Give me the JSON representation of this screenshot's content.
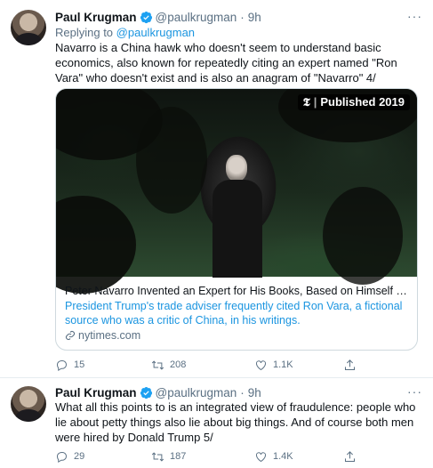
{
  "tweets": [
    {
      "author": {
        "name": "Paul Krugman",
        "handle": "@paulkrugman",
        "separator": "·",
        "time": "9h"
      },
      "more_icon": "ellipsis-icon",
      "replying_prefix": "Replying to",
      "replying_handle": "@paulkrugman",
      "text": "Navarro is a China hawk who doesn't seem to understand basic economics, also known for repeatedly citing an expert named \"Ron Vara\" who doesn't exist and is also an anagram of \"Navarro\" 4/",
      "card": {
        "badge_logo": "𝕿",
        "badge_sep": "|",
        "badge_text": "Published 2019",
        "title": "Peter Navarro Invented an Expert for His Books, Based on Himself (Publi...",
        "description": "President Trump's trade adviser frequently cited Ron Vara, a fictional source who was a critic of China, in his writings.",
        "domain": "nytimes.com"
      },
      "actions": {
        "replies": "15",
        "retweets": "208",
        "likes": "1.1K"
      }
    },
    {
      "author": {
        "name": "Paul Krugman",
        "handle": "@paulkrugman",
        "separator": "·",
        "time": "9h"
      },
      "more_icon": "ellipsis-icon",
      "text": "What all this points to is an integrated view of fraudulence: people who lie about petty things also lie about big things. And of course both men were hired by Donald Trump 5/",
      "actions": {
        "replies": "29",
        "retweets": "187",
        "likes": "1.4K"
      }
    }
  ],
  "colors": {
    "link": "#1b95e0",
    "muted": "#5b7083",
    "verified": "#1da1f2"
  },
  "more_glyph": "···"
}
